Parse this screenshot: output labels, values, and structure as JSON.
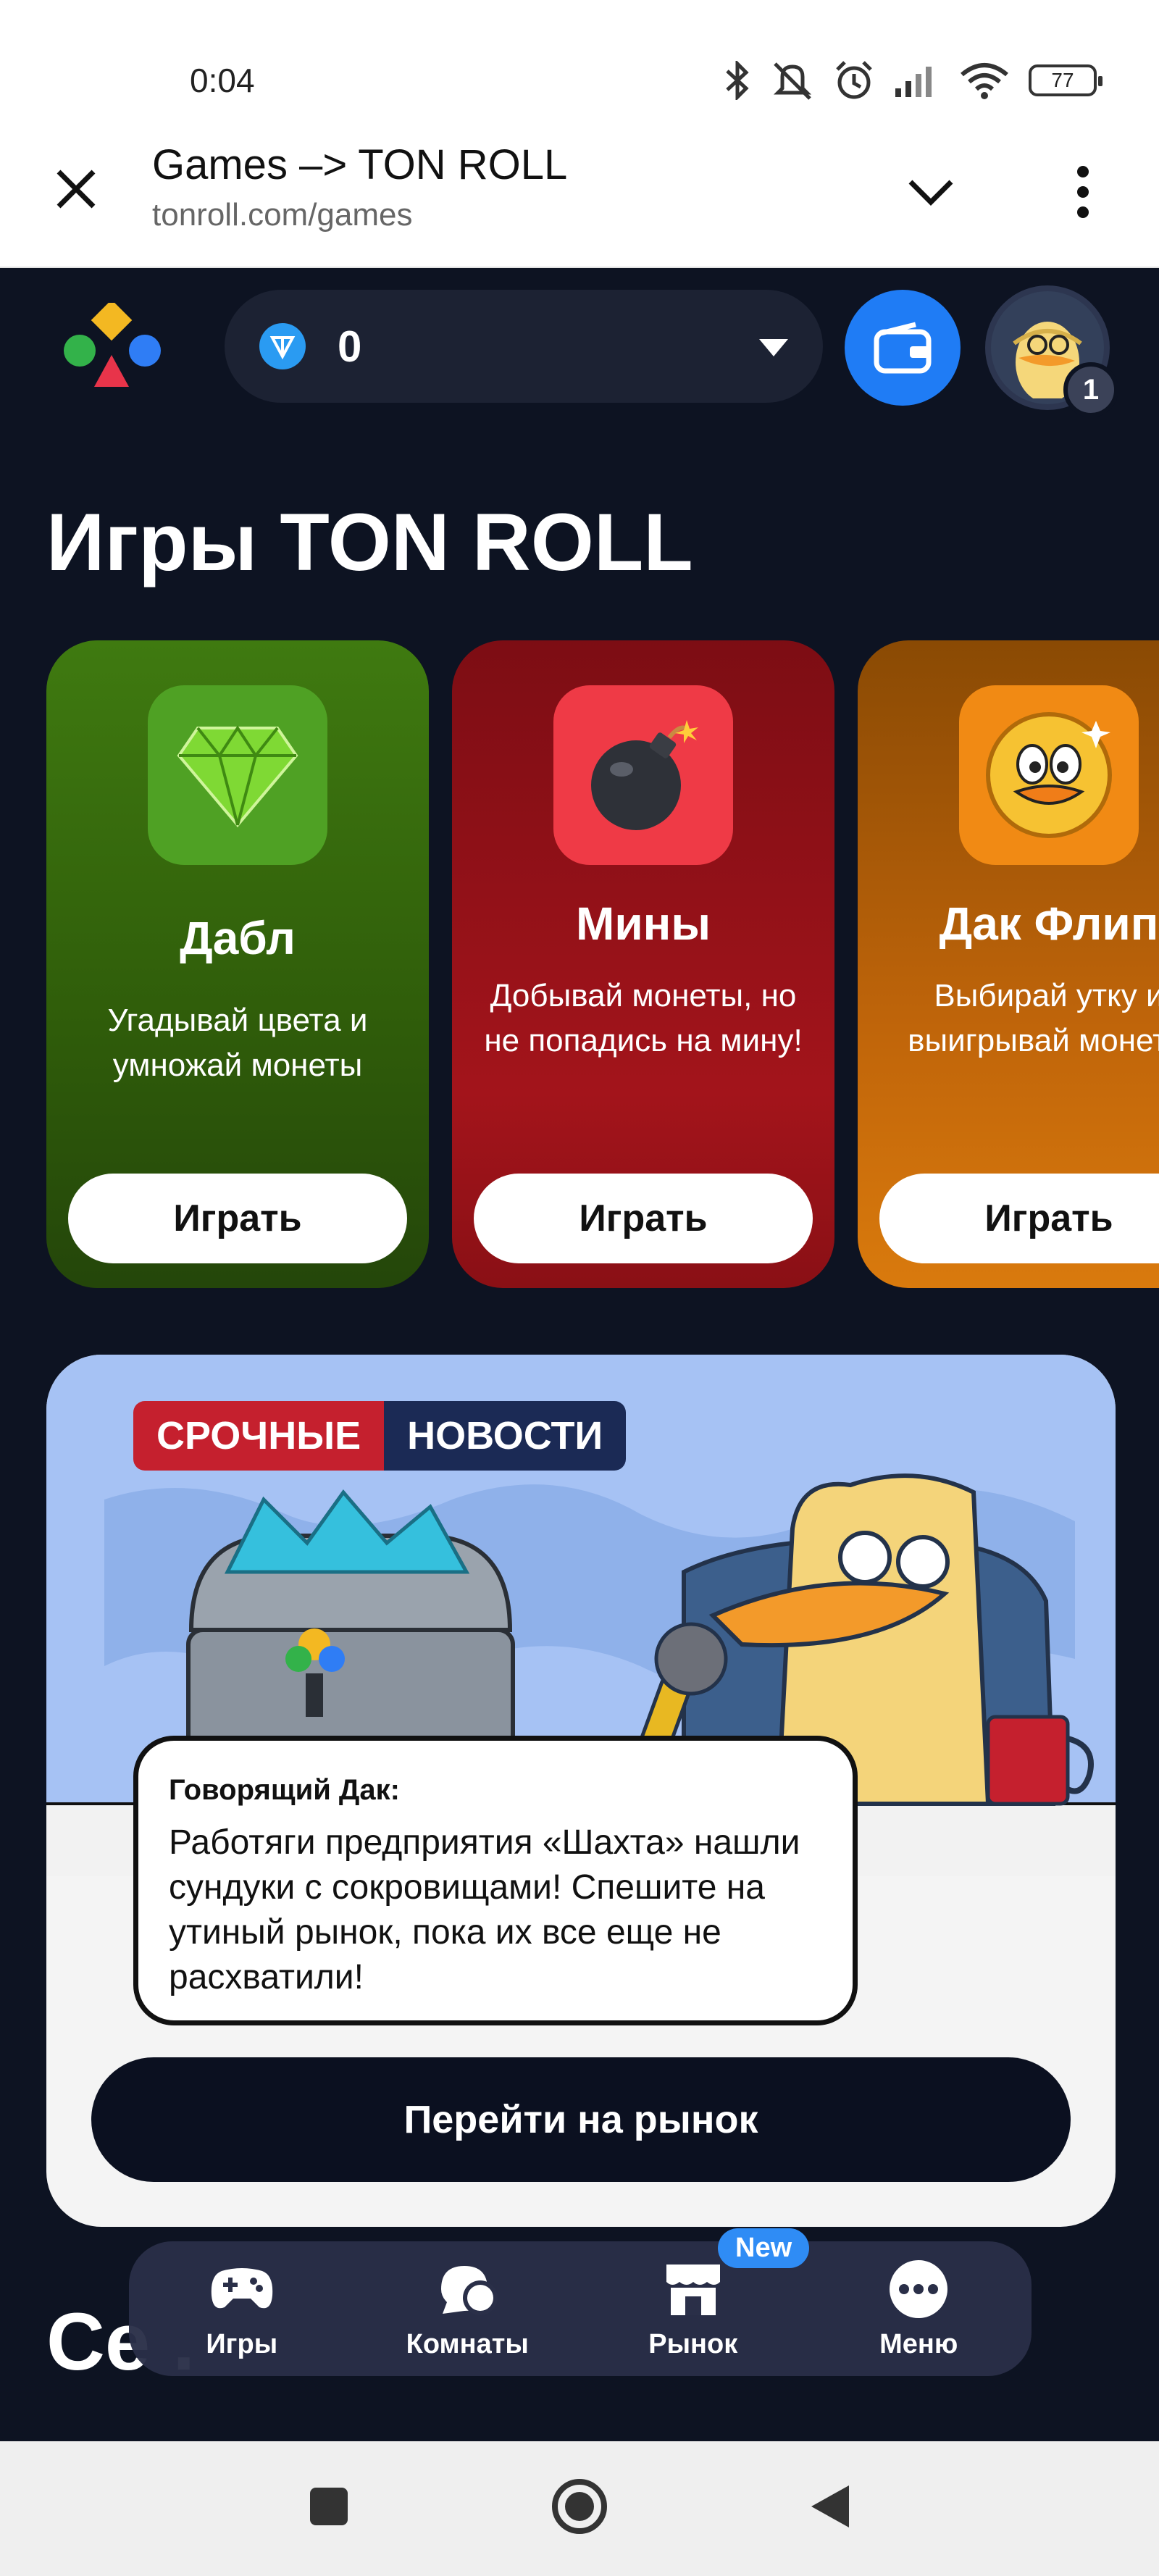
{
  "status_bar": {
    "time": "0:04",
    "battery": "77",
    "icons": [
      "bluetooth-icon",
      "mute-icon",
      "alarm-icon",
      "signal-icon",
      "wifi-icon",
      "battery-icon"
    ]
  },
  "browser": {
    "title": "Games –> TON ROLL",
    "url": "tonroll.com/games"
  },
  "header": {
    "balance": "0",
    "avatar_badge": "1"
  },
  "page": {
    "title": "Игры TON ROLL",
    "partial_section_title": "Се             ."
  },
  "games": [
    {
      "name": "Дабл",
      "description": "Угадывай цвета и умножай монеты",
      "button": "Играть",
      "icon": "gem-icon"
    },
    {
      "name": "Мины",
      "description": "Добывай монеты, но не попадись на мину!",
      "button": "Играть",
      "icon": "bomb-icon"
    },
    {
      "name": "Дак Флип",
      "description": "Выбирай утку и выигрывай монеты",
      "button": "Играть",
      "icon": "duck-coin-icon"
    }
  ],
  "news": {
    "tag_part1": "СРОЧНЫЕ",
    "tag_part2": "НОВОСТИ",
    "author": "Говорящий Дак:",
    "text": "Работяги предприятия «Шахта» нашли сундуки с сокровищами! Спешите на утиный рынок, пока их все еще не расхватили!",
    "button": "Перейти на рынок"
  },
  "bottom_nav": {
    "items": [
      {
        "label": "Игры",
        "icon": "gamepad-icon"
      },
      {
        "label": "Комнаты",
        "icon": "rooms-icon"
      },
      {
        "label": "Рынок",
        "icon": "market-icon"
      },
      {
        "label": "Меню",
        "icon": "menu-dots-icon"
      }
    ],
    "new_badge": "New"
  },
  "colors": {
    "background": "#0d1322",
    "accent_blue": "#1f7cf5",
    "news_red": "#c5202e",
    "news_navy": "#1b2a55"
  }
}
